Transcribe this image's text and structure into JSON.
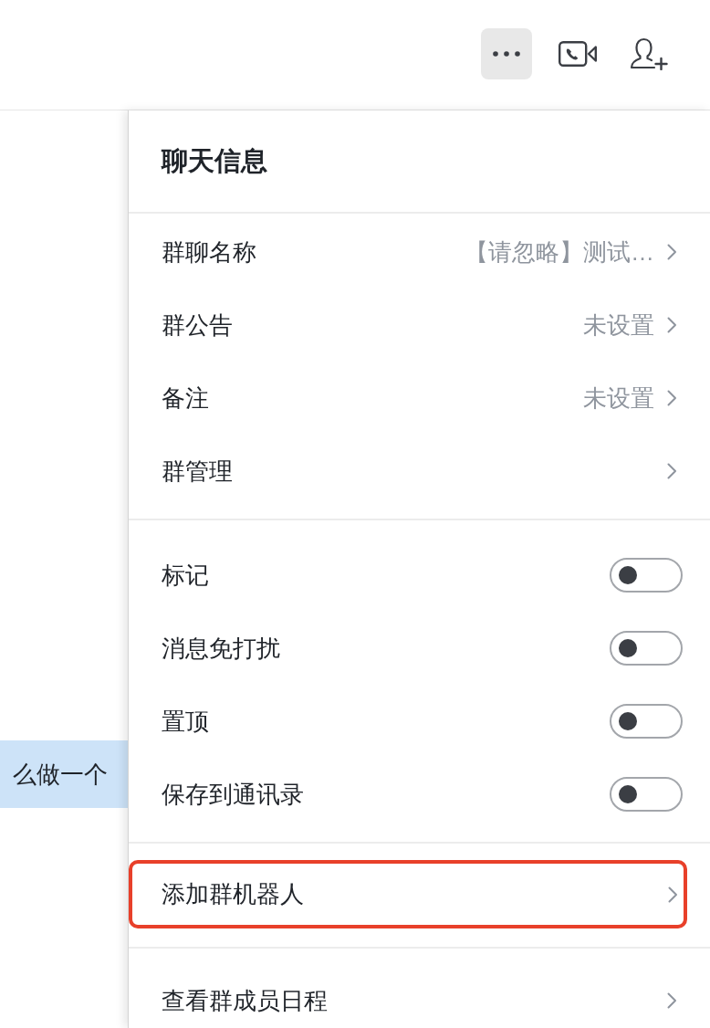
{
  "toolbar": {
    "buttons": [
      {
        "kind": "more",
        "active": true
      },
      {
        "kind": "video_call",
        "active": false
      },
      {
        "kind": "add_member",
        "active": false
      }
    ]
  },
  "chat": {
    "messages": [
      {
        "text": "么做一个"
      }
    ]
  },
  "panel": {
    "title": "聊天信息",
    "sections": [
      {
        "items": [
          {
            "kind": "link",
            "label": "群聊名称",
            "value": "【请忽略】测试…",
            "highlighted": false
          },
          {
            "kind": "link",
            "label": "群公告",
            "value": "未设置",
            "highlighted": false
          },
          {
            "kind": "link",
            "label": "备注",
            "value": "未设置",
            "highlighted": false
          },
          {
            "kind": "link",
            "label": "群管理",
            "highlighted": false
          }
        ]
      },
      {
        "items": [
          {
            "kind": "toggle",
            "label": "标记",
            "on": false
          },
          {
            "kind": "toggle",
            "label": "消息免打扰",
            "on": false
          },
          {
            "kind": "toggle",
            "label": "置顶",
            "on": false
          },
          {
            "kind": "toggle",
            "label": "保存到通讯录",
            "on": false
          }
        ]
      },
      {
        "items": [
          {
            "kind": "link",
            "label": "添加群机器人",
            "highlighted": true
          }
        ]
      },
      {
        "items": [
          {
            "kind": "link",
            "label": "查看群成员日程",
            "highlighted": false
          }
        ]
      }
    ]
  }
}
